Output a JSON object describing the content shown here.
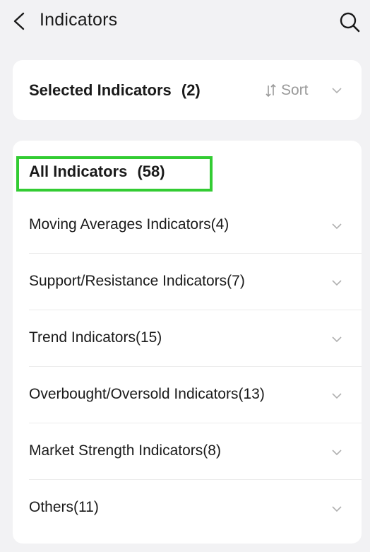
{
  "header": {
    "title": "Indicators",
    "back_icon": "chevron-left-icon",
    "search_icon": "search-icon"
  },
  "selected": {
    "title": "Selected Indicators",
    "count": "(2)",
    "sort_label": "Sort"
  },
  "all": {
    "title": "All Indicators",
    "count": "(58)",
    "highlight_color": "#33cc33",
    "categories": [
      {
        "label": "Moving Averages Indicators(4)"
      },
      {
        "label": "Support/Resistance Indicators(7)"
      },
      {
        "label": "Trend Indicators(15)"
      },
      {
        "label": "Overbought/Oversold Indicators(13)"
      },
      {
        "label": "Market Strength Indicators(8)"
      },
      {
        "label": "Others(11)"
      }
    ]
  }
}
